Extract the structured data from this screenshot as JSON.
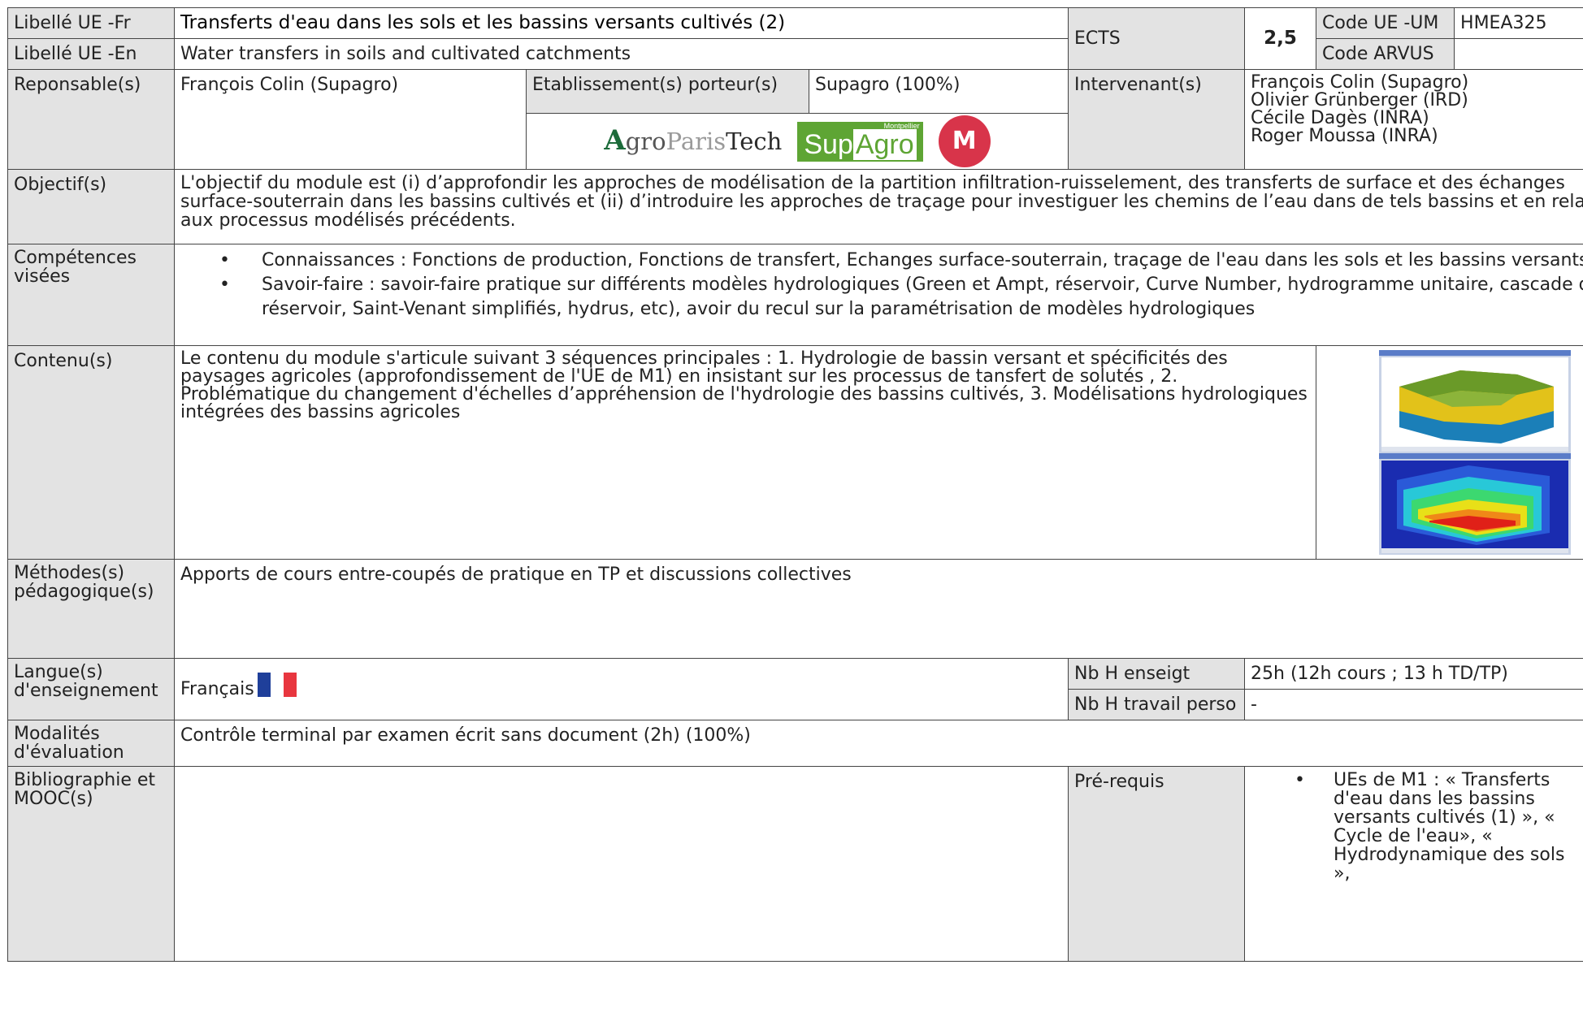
{
  "labels": {
    "libelle_fr": "Libellé UE -Fr",
    "libelle_en": "Libellé UE -En",
    "ects": "ECTS",
    "code_um": "Code UE -UM",
    "code_arvus": "Code ARVUS",
    "responsables": "Reponsable(s)",
    "etablissements": "Etablissement(s) porteur(s)",
    "intervenants": "Intervenant(s)",
    "objectifs": "Objectif(s)",
    "competences": "Compétences visées",
    "contenu": "Contenu(s)",
    "methodes": "Méthodes(s) pédagogique(s)",
    "langue": "Langue(s) d'enseignement",
    "nb_h_enseigt": "Nb H enseigt",
    "nb_h_perso": "Nb H travail perso",
    "modalites": "Modalités d'évaluation",
    "bibliographie": "Bibliographie et MOOC(s)",
    "prerequis": "Pré-requis"
  },
  "values": {
    "title_fr": "Transferts d'eau dans les sols et les bassins versants cultivés (2)",
    "title_en": "Water transfers in soils and cultivated catchments",
    "ects": "2,5",
    "code_um": "HMEA325",
    "code_arvus": "",
    "responsable": "François Colin (Supagro)",
    "etablissement": "Supagro (100%)",
    "intervenants": [
      "François Colin (Supagro)",
      "Olivier Grünberger (IRD)",
      "Cécile Dagès (INRA)",
      "Roger Moussa (INRA)"
    ],
    "objectif": "L'objectif du module est (i) d’approfondir les approches de modélisation de la partition infiltration-ruisselement, des transferts de surface et des échanges surface-souterrain dans les bassins cultivés et (ii) d’introduire les approches de traçage pour investiguer les chemins de l’eau dans de tels bassins et en relation aux processus modélisés précédents.",
    "competences": [
      "Connaissances : Fonctions de production, Fonctions de transfert, Echanges surface-souterrain, traçage de l'eau dans les sols et les bassins versants",
      "Savoir-faire : savoir-faire pratique sur différents modèles hydrologiques (Green et Ampt, réservoir, Curve Number, hydrogramme unitaire, cascade de réservoir, Saint-Venant simplifiés, hydrus, etc), avoir du recul sur la paramétrisation de modèles hydrologiques"
    ],
    "contenu": "Le contenu du module s'articule suivant 3 séquences principales : 1. Hydrologie de bassin versant et spécificités des paysages agricoles (approfondissement de l'UE de M1) en insistant sur les processus de tansfert de solutés , 2. Problématique du changement d'échelles d’appréhension de l'hydrologie des bassins cultivés, 3. Modélisations hydrologiques intégrées des bassins agricoles",
    "methodes": "Apports de cours entre-coupés de pratique en TP et discussions collectives",
    "langue": "Français",
    "nb_h_enseigt": "25h (12h cours ; 13 h TD/TP)",
    "nb_h_perso": "-",
    "modalites": "Contrôle terminal par examen écrit sans document (2h) (100%)",
    "bibliographie": "",
    "prerequis": [
      "UEs de M1 : « Transferts d'eau dans les bassins versants cultivés (1) », « Cycle de l'eau», « Hydrodynamique des sols »,"
    ]
  },
  "logos": {
    "agroparistech": {
      "a": "A",
      "gro": "gro",
      "paris": "Paris",
      "tech": "Tech"
    },
    "supagro": {
      "mtp": "Montpellier",
      "sup": "Sup",
      "agro": "Agro"
    },
    "um": "M"
  },
  "colors": {
    "label_bg": "#e3e3e3",
    "flag_blue": "#1f3f9a",
    "flag_white": "#ffffff",
    "flag_red": "#e8363f",
    "supagro_green": "#5ea534",
    "um_red": "#d8344a"
  }
}
